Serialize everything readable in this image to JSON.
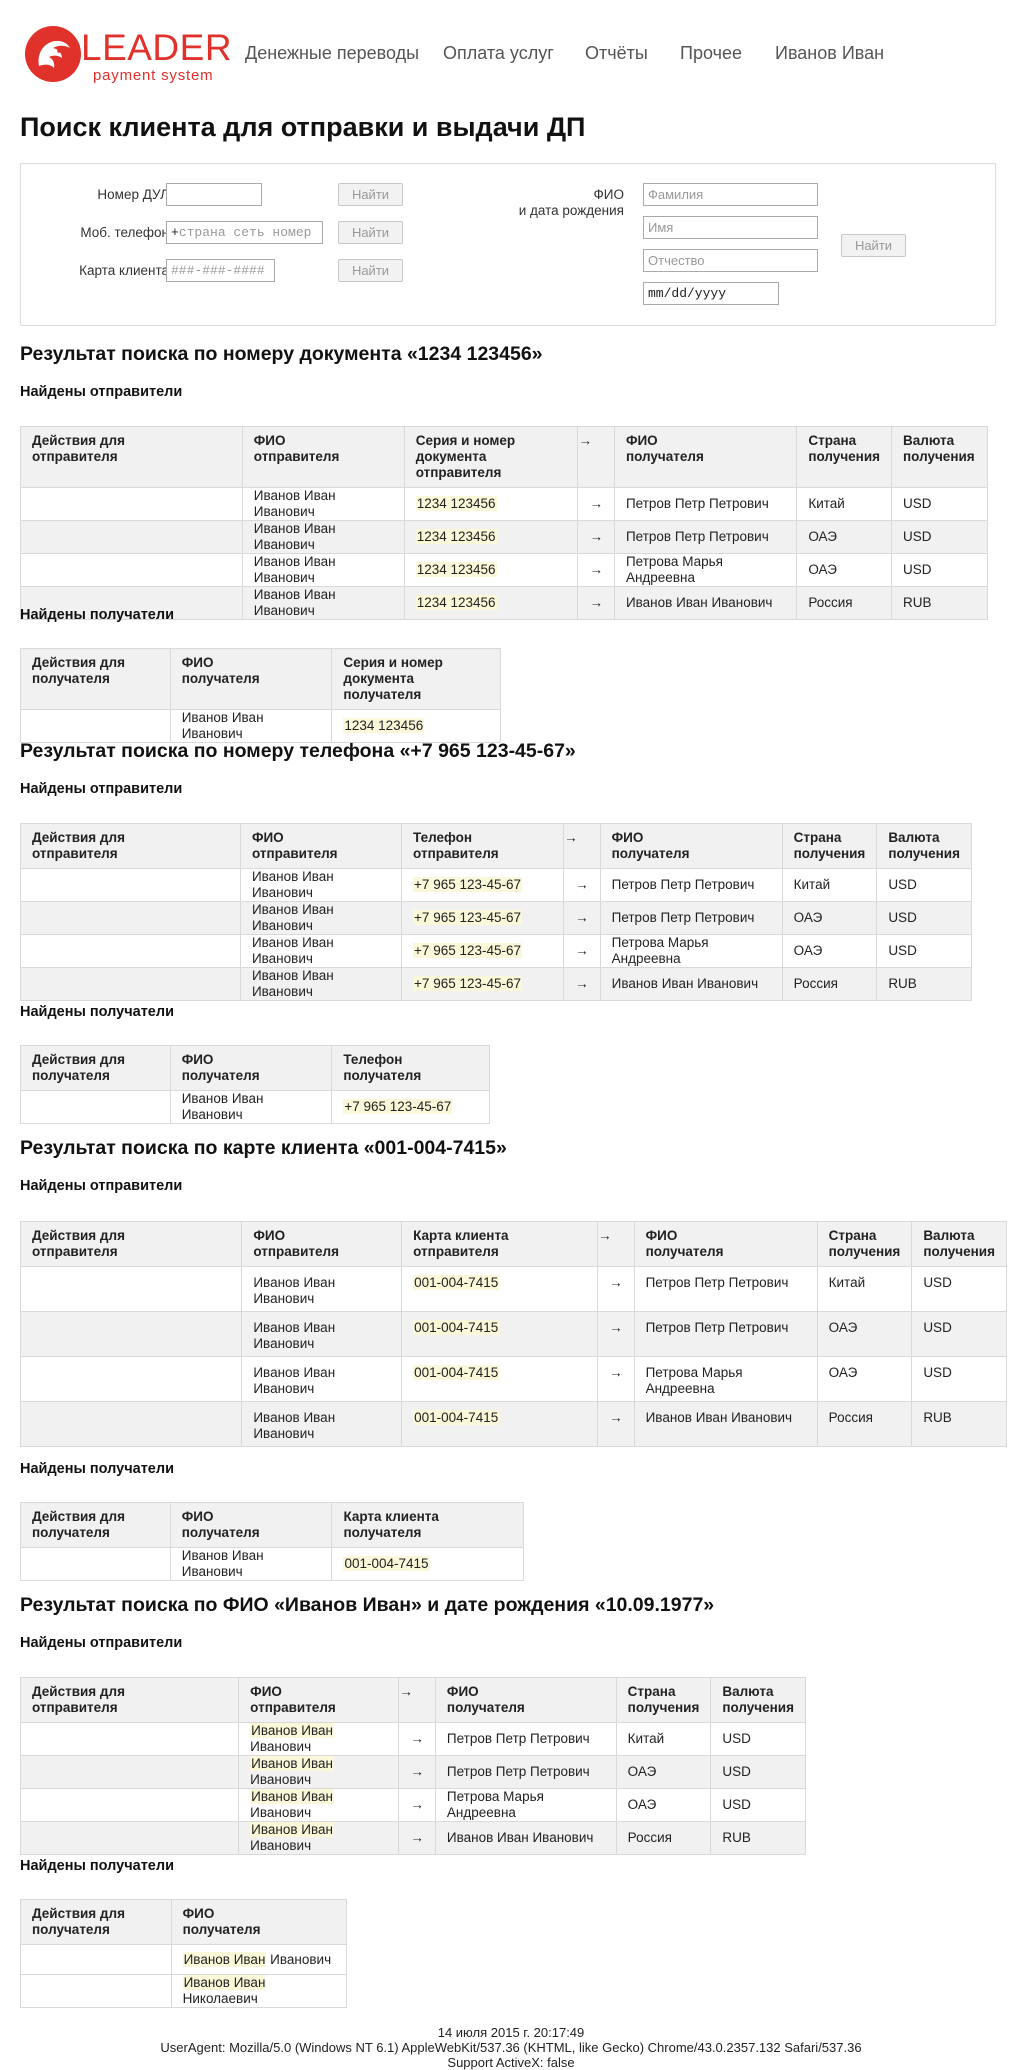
{
  "header": {
    "logo_word": "LEADER",
    "logo_sub": "payment system",
    "nav": [
      "Денежные переводы",
      "Оплата услуг",
      "Отчёты",
      "Прочее",
      "Иванов Иван"
    ]
  },
  "page_title": "Поиск клиента для отправки и выдачи ДП",
  "search": {
    "doc_label": "Номер ДУЛ",
    "phone_label": "Моб. телефон",
    "phone_prefix": "+",
    "phone_placeholder": "страна сеть номер",
    "card_label": "Карта клиента",
    "card_placeholder": "###-###-####",
    "find_label": "Найти",
    "fio_label_1": "ФИО",
    "fio_label_2": "и дата рождения",
    "surname_placeholder": "Фамилия",
    "name_placeholder": "Имя",
    "patronymic_placeholder": "Отчество",
    "date_placeholder": "mm/dd/yyyy"
  },
  "common": {
    "senders_found": "Найдены отправители",
    "receivers_found": "Найдены получатели",
    "arrow": "→",
    "h_sender_actions_1": "Действия для",
    "h_sender_actions_2": "отправителя",
    "h_receiver_actions_1": "Действия для",
    "h_receiver_actions_2": "получателя",
    "h_fio": "ФИО",
    "h_sender_2": "отправителя",
    "h_receiver_2": "получателя",
    "h_country_1": "Страна",
    "h_country_2": "получения",
    "h_currency_1": "Валюта",
    "h_currency_2": "получения"
  },
  "sec_doc": {
    "title": "Результат поиска по номеру документа «1234 123456»",
    "h_doc_s_1": "Серия и номер",
    "h_doc_s_2": "документа отправителя",
    "h_doc_r_1": "Серия и номер",
    "h_doc_r_2": "документа получателя",
    "senders": [
      {
        "fio": "Иванов Иван Иванович",
        "key": "1234 123456",
        "recv": "Петров Петр Петрович",
        "country": "Китай",
        "currency": "USD"
      },
      {
        "fio": "Иванов Иван Иванович",
        "key": "1234 123456",
        "recv": "Петров Петр Петрович",
        "country": "ОАЭ",
        "currency": "USD"
      },
      {
        "fio": "Иванов Иван Иванович",
        "key": "1234 123456",
        "recv": "Петрова Марья Андреевна",
        "country": "ОАЭ",
        "currency": "USD"
      },
      {
        "fio": "Иванов Иван Иванович",
        "key": "1234 123456",
        "recv": "Иванов Иван Иванович",
        "country": "Россия",
        "currency": "RUB"
      }
    ],
    "receivers": [
      {
        "fio": "Иванов Иван Иванович",
        "key": "1234 123456"
      }
    ]
  },
  "sec_phone": {
    "title": "Результат поиска по номеру телефона «+7 965 123-45-67»",
    "h_key_s": "Телефон отправителя",
    "h_key_r": "Телефон получателя",
    "senders": [
      {
        "fio": "Иванов Иван Иванович",
        "key": "+7 965 123-45-67",
        "recv": "Петров Петр Петрович",
        "country": "Китай",
        "currency": "USD"
      },
      {
        "fio": "Иванов Иван Иванович",
        "key": "+7 965 123-45-67",
        "recv": "Петров Петр Петрович",
        "country": "ОАЭ",
        "currency": "USD"
      },
      {
        "fio": "Иванов Иван Иванович",
        "key": "+7 965 123-45-67",
        "recv": "Петрова Марья Андреевна",
        "country": "ОАЭ",
        "currency": "USD"
      },
      {
        "fio": "Иванов Иван Иванович",
        "key": "+7 965 123-45-67",
        "recv": "Иванов Иван Иванович",
        "country": "Россия",
        "currency": "RUB"
      }
    ],
    "receivers": [
      {
        "fio": "Иванов Иван Иванович",
        "key": "+7 965 123-45-67"
      }
    ]
  },
  "sec_card": {
    "title": "Результат поиска по карте клиента «001-004-7415»",
    "h_key_s": "Карта клиента отправителя",
    "h_key_r": "Карта клиента получателя",
    "senders": [
      {
        "fio_1": "Иванов Иван",
        "fio_2": "Иванович",
        "key": "001-004-7415",
        "recv": "Петров Петр Петрович",
        "country": "Китай",
        "currency": "USD"
      },
      {
        "fio_1": "Иванов Иван",
        "fio_2": "Иванович",
        "key": "001-004-7415",
        "recv": "Петров Петр Петрович",
        "country": "ОАЭ",
        "currency": "USD"
      },
      {
        "fio_1": "Иванов Иван",
        "fio_2": "Иванович",
        "key": "001-004-7415",
        "recv": "Петрова Марья Андреевна",
        "country": "ОАЭ",
        "currency": "USD"
      },
      {
        "fio_1": "Иванов Иван",
        "fio_2": "Иванович",
        "key": "001-004-7415",
        "recv": "Иванов Иван Иванович",
        "country": "Россия",
        "currency": "RUB"
      }
    ],
    "receivers": [
      {
        "fio": "Иванов Иван Иванович",
        "key": "001-004-7415"
      }
    ]
  },
  "sec_fio": {
    "title": "Результат поиска по ФИО «Иванов Иван» и дате рождения «10.09.1977»",
    "senders": [
      {
        "fio_hl": "Иванов Иван",
        "fio_rest": "Иванович",
        "recv": "Петров Петр Петрович",
        "country": "Китай",
        "currency": "USD"
      },
      {
        "fio_hl": "Иванов Иван",
        "fio_rest": "Иванович",
        "recv": "Петров Петр Петрович",
        "country": "ОАЭ",
        "currency": "USD"
      },
      {
        "fio_hl": "Иванов Иван",
        "fio_rest": "Иванович",
        "recv": "Петрова Марья Андреевна",
        "country": "ОАЭ",
        "currency": "USD"
      },
      {
        "fio_hl": "Иванов Иван",
        "fio_rest": "Иванович",
        "recv": "Иванов Иван Иванович",
        "country": "Россия",
        "currency": "RUB"
      }
    ],
    "receivers": [
      {
        "fio_hl": "Иванов Иван",
        "fio_rest": "Иванович"
      },
      {
        "fio_hl": "Иванов Иван",
        "fio_rest": "Николаевич"
      }
    ]
  },
  "footer": {
    "date": "14 июля 2015 г. 20:17:49",
    "ua": "UserAgent: Mozilla/5.0 (Windows NT 6.1) AppleWebKit/537.36 (KHTML, like Gecko) Chrome/43.0.2357.132 Safari/537.36",
    "activex": "Support ActiveX: false"
  },
  "colors": {
    "brand": "#e0312b",
    "usd": "#2e8b1f",
    "rub": "#e0312b",
    "highlight": "#fbf7d9"
  }
}
